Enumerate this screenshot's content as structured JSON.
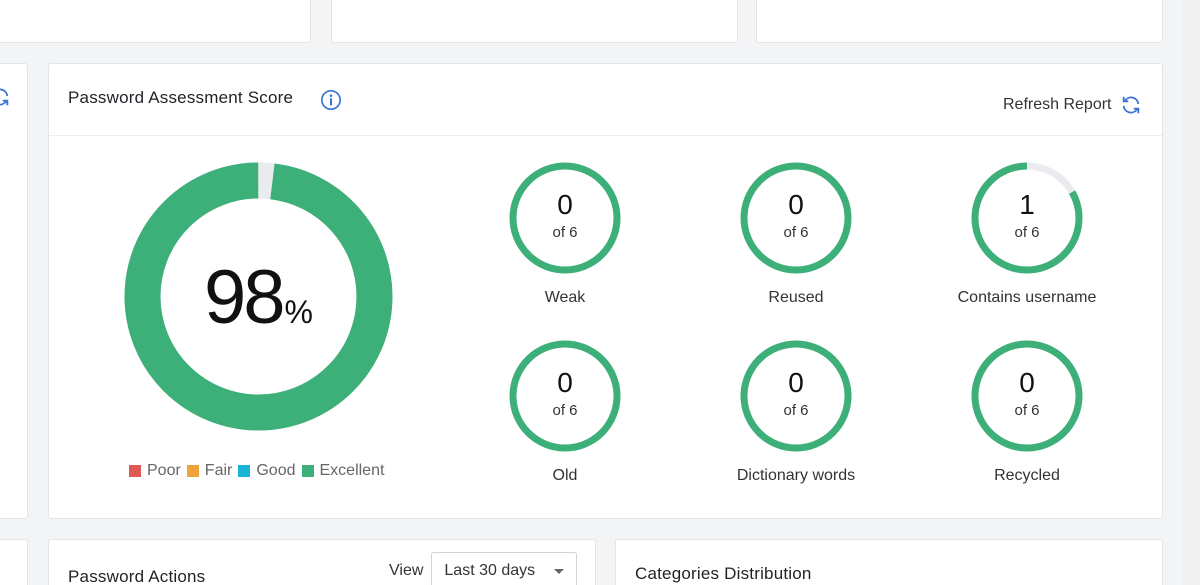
{
  "assessment": {
    "title": "Password Assessment Score",
    "refresh_label": "Refresh Report",
    "score": {
      "value": "98",
      "unit": "%",
      "fraction": 0.98
    },
    "legend": [
      {
        "label": "Poor",
        "color": "#e05a55"
      },
      {
        "label": "Fair",
        "color": "#f0a23a"
      },
      {
        "label": "Good",
        "color": "#19b4d8"
      },
      {
        "label": "Excellent",
        "color": "#3daf79"
      }
    ],
    "metrics": [
      {
        "count": "0",
        "of": "of 6",
        "label": "Weak",
        "fraction": 1.0
      },
      {
        "count": "0",
        "of": "of 6",
        "label": "Reused",
        "fraction": 1.0
      },
      {
        "count": "1",
        "of": "of 6",
        "label": "Contains username",
        "fraction": 0.8333
      },
      {
        "count": "0",
        "of": "of 6",
        "label": "Old",
        "fraction": 1.0
      },
      {
        "count": "0",
        "of": "of 6",
        "label": "Dictionary words",
        "fraction": 1.0
      },
      {
        "count": "0",
        "of": "of 6",
        "label": "Recycled",
        "fraction": 1.0
      }
    ]
  },
  "password_actions": {
    "title": "Password Actions",
    "view_label": "View",
    "view_selected": "Last 30 days"
  },
  "categories": {
    "title": "Categories Distribution"
  },
  "colors": {
    "accent_green": "#3daf79",
    "ring_bg": "#e9ebee",
    "icon_blue": "#3b74d6"
  }
}
